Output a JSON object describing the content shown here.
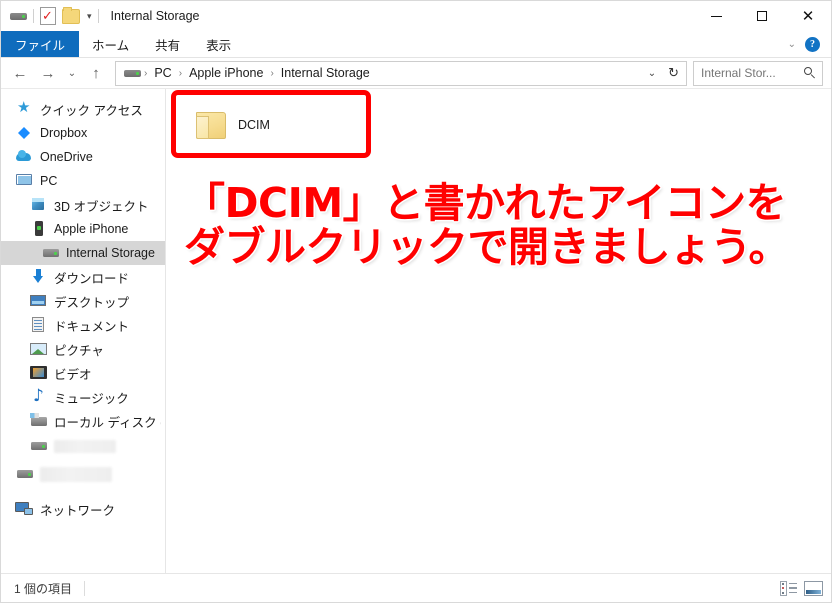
{
  "window": {
    "title": "Internal Storage",
    "quick_access_toolbar": [
      {
        "name": "drive-icon",
        "label": ""
      },
      {
        "name": "properties-icon",
        "label": ""
      },
      {
        "name": "new-folder-icon",
        "label": ""
      },
      {
        "name": "customize-chevron-icon",
        "label": "▾"
      }
    ],
    "controls": {
      "minimize": "—",
      "maximize": "□",
      "close": "✕"
    }
  },
  "ribbon": {
    "tabs": [
      {
        "label": "ファイル",
        "active": true
      },
      {
        "label": "ホーム",
        "active": false
      },
      {
        "label": "共有",
        "active": false
      },
      {
        "label": "表示",
        "active": false
      }
    ],
    "collapse_chevron": "⌄",
    "help_label": "?"
  },
  "addressbar": {
    "back": "←",
    "forward": "→",
    "recent": "⌄",
    "up": "↑",
    "breadcrumbs": [
      {
        "label": "PC"
      },
      {
        "label": "Apple iPhone"
      },
      {
        "label": "Internal Storage"
      }
    ],
    "separator": "›",
    "dropdown": "⌄",
    "refresh": "↻"
  },
  "search": {
    "placeholder": "Internal Stor...",
    "icon": "search-icon"
  },
  "navpane": {
    "items": [
      {
        "label": "クイック アクセス",
        "icon": "star-icon",
        "indent": 0,
        "selected": false,
        "redacted": false
      },
      {
        "label": "Dropbox",
        "icon": "dropbox-icon",
        "indent": 0,
        "selected": false,
        "redacted": false
      },
      {
        "label": "OneDrive",
        "icon": "cloud-icon",
        "indent": 0,
        "selected": false,
        "redacted": false
      },
      {
        "label": "PC",
        "icon": "computer-icon",
        "indent": 0,
        "selected": false,
        "redacted": false
      },
      {
        "label": "3D オブジェクト",
        "icon": "cube-icon",
        "indent": 1,
        "selected": false,
        "redacted": false
      },
      {
        "label": "Apple iPhone",
        "icon": "phone-icon",
        "indent": 1,
        "selected": false,
        "redacted": false
      },
      {
        "label": "Internal Storage",
        "icon": "drive-icon",
        "indent": 2,
        "selected": true,
        "redacted": false
      },
      {
        "label": "ダウンロード",
        "icon": "download-icon",
        "indent": 1,
        "selected": false,
        "redacted": false
      },
      {
        "label": "デスクトップ",
        "icon": "desktop-icon",
        "indent": 1,
        "selected": false,
        "redacted": false
      },
      {
        "label": "ドキュメント",
        "icon": "document-icon",
        "indent": 1,
        "selected": false,
        "redacted": false
      },
      {
        "label": "ピクチャ",
        "icon": "picture-icon",
        "indent": 1,
        "selected": false,
        "redacted": false
      },
      {
        "label": "ビデオ",
        "icon": "video-icon",
        "indent": 1,
        "selected": false,
        "redacted": false
      },
      {
        "label": "ミュージック",
        "icon": "music-icon",
        "indent": 1,
        "selected": false,
        "redacted": false
      },
      {
        "label": "ローカル ディスク (C:)",
        "icon": "local-disk-icon",
        "indent": 1,
        "selected": false,
        "redacted": false
      },
      {
        "label": "",
        "icon": "drive-icon",
        "indent": 1,
        "selected": false,
        "redacted": true
      },
      {
        "label": "",
        "icon": "drive-icon",
        "indent": 0,
        "selected": false,
        "redacted": true
      },
      {
        "label": "ネットワーク",
        "icon": "network-icon",
        "indent": 0,
        "selected": false,
        "redacted": false
      }
    ]
  },
  "content": {
    "files": [
      {
        "name": "DCIM",
        "type": "folder",
        "highlighted": true
      }
    ]
  },
  "annotation": {
    "line1": "「DCIM」と書かれたアイコンを",
    "line2": "ダブルクリックで開きましょう。",
    "color": "#ff0000"
  },
  "highlight": {
    "box_color": "#ff0000"
  },
  "statusbar": {
    "item_count": "1 個の項目",
    "views": [
      {
        "name": "details-view-icon",
        "active": false
      },
      {
        "name": "large-icons-view-icon",
        "active": true
      }
    ]
  }
}
